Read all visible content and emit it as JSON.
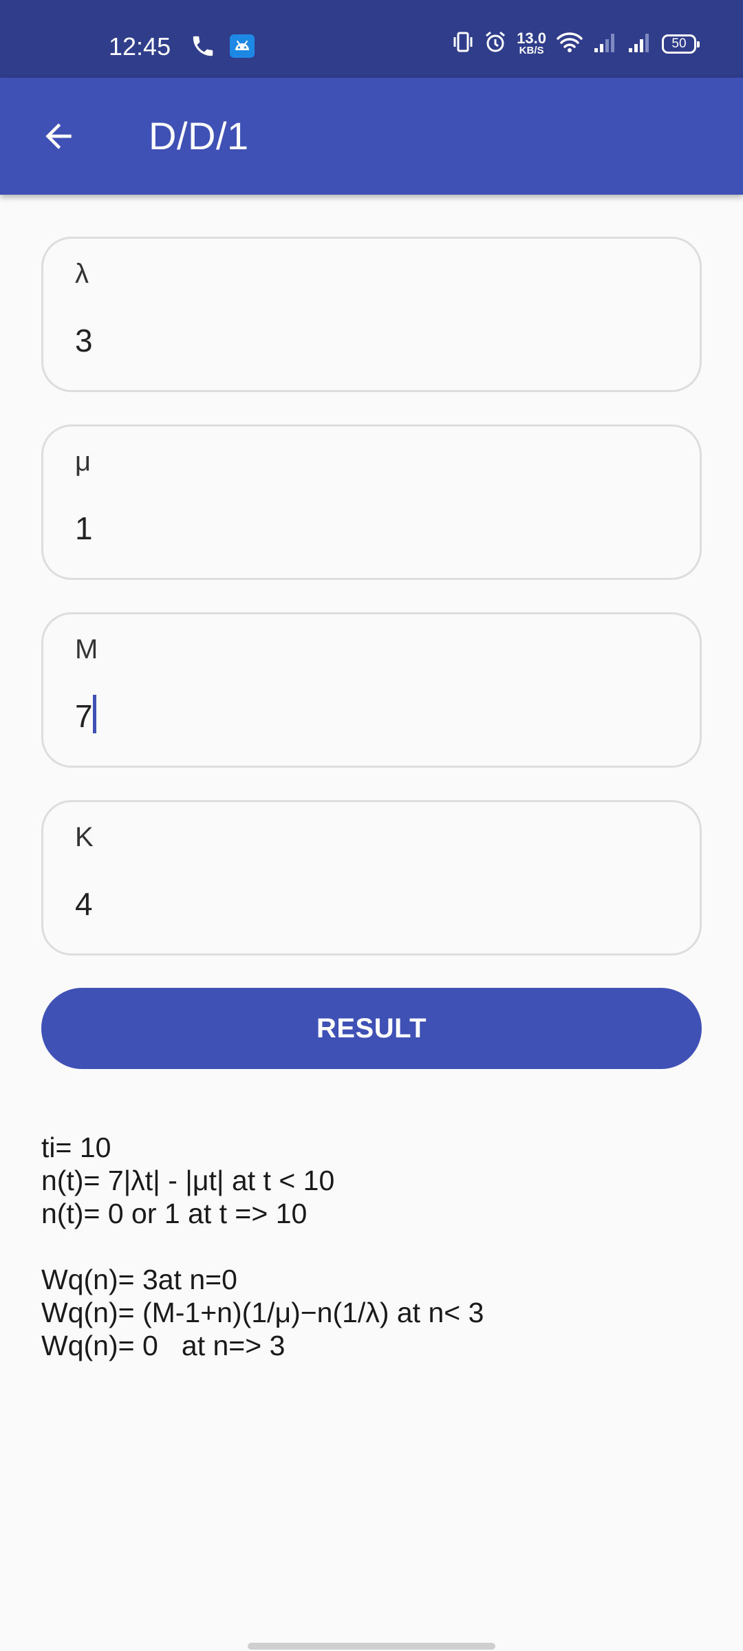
{
  "status_bar": {
    "time": "12:45",
    "net_speed": "13.0",
    "net_speed_unit": "KB/S",
    "battery": "50",
    "icons": [
      "phone-icon",
      "android-icon",
      "vibrate-icon",
      "alarm-icon",
      "wifi-icon",
      "signal-icon",
      "signal-icon"
    ]
  },
  "app_bar": {
    "title": "D/D/1",
    "back_icon": "arrow-back-icon"
  },
  "form": {
    "lambda": {
      "label": "λ",
      "value": "3"
    },
    "mu": {
      "label": "μ",
      "value": "1"
    },
    "m": {
      "label": "M",
      "value": "7"
    },
    "k": {
      "label": "K",
      "value": "4"
    }
  },
  "result_button": {
    "label": "RESULT"
  },
  "results": {
    "block1": [
      "ti= 10",
      "n(t)= 7|λt| - |μt| at t < 10",
      "n(t)= 0 or 1 at t => 10"
    ],
    "block2": [
      "Wq(n)= 3at n=0",
      "Wq(n)= (M-1+n)(1/μ)−n(1/λ) at n< 3",
      "Wq(n)= 0   at n=> 3"
    ]
  },
  "colors": {
    "status_bar": "#2f3d8a",
    "primary": "#3f51b5",
    "background": "#fafafa",
    "field_border": "#dddddd"
  }
}
